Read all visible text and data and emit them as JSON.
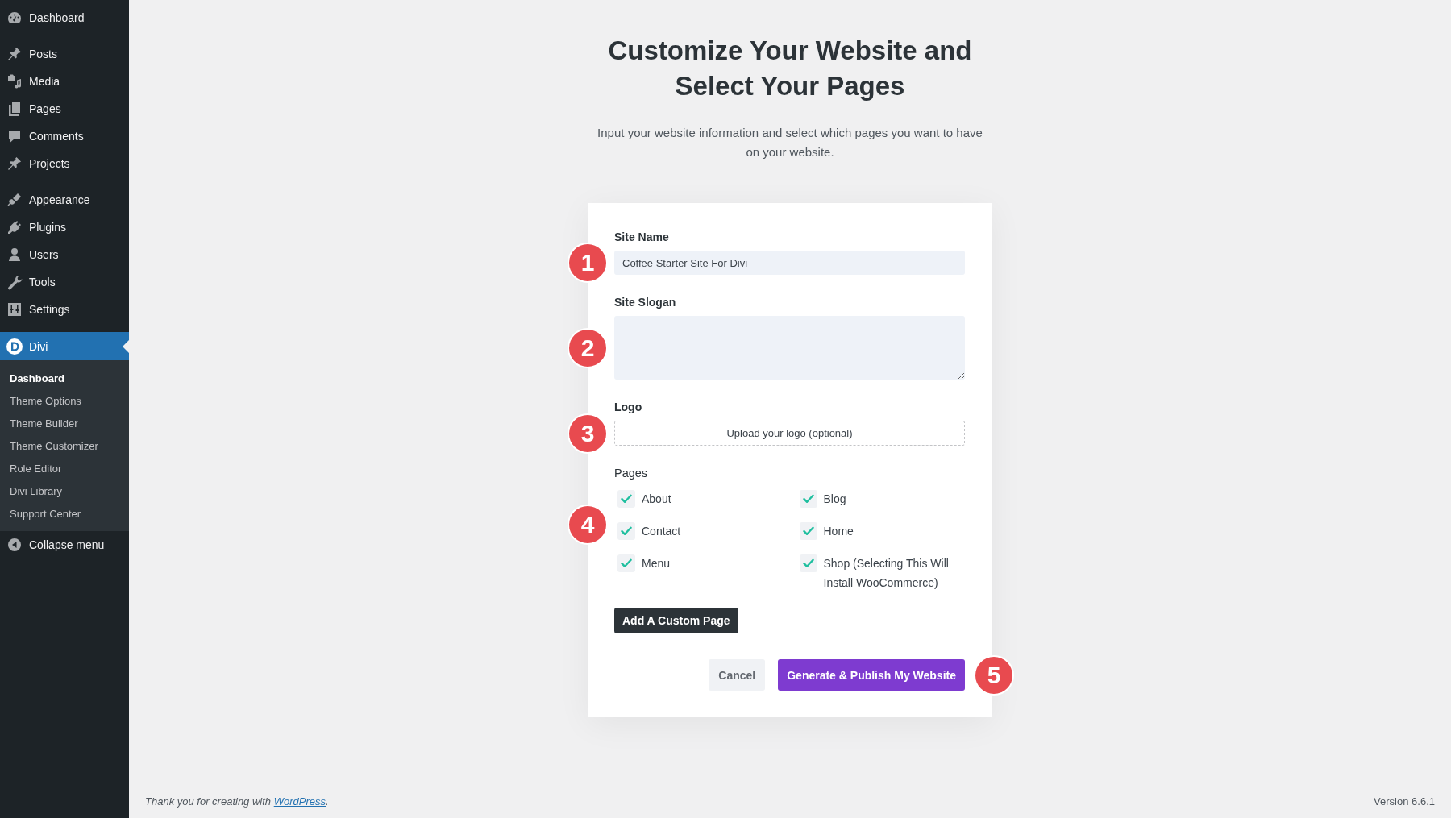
{
  "sidebar": {
    "groups": [
      [
        {
          "label": "Dashboard",
          "selected": false
        }
      ],
      [
        {
          "label": "Posts",
          "selected": false
        },
        {
          "label": "Media",
          "selected": false
        },
        {
          "label": "Pages",
          "selected": false
        },
        {
          "label": "Comments",
          "selected": false
        },
        {
          "label": "Projects",
          "selected": false
        }
      ],
      [
        {
          "label": "Appearance",
          "selected": false
        },
        {
          "label": "Plugins",
          "selected": false
        },
        {
          "label": "Users",
          "selected": false
        },
        {
          "label": "Tools",
          "selected": false
        },
        {
          "label": "Settings",
          "selected": false
        }
      ],
      [
        {
          "label": "Divi",
          "selected": true,
          "submenu": [
            {
              "label": "Dashboard",
              "selected": true
            },
            {
              "label": "Theme Options",
              "selected": false
            },
            {
              "label": "Theme Builder",
              "selected": false
            },
            {
              "label": "Theme Customizer",
              "selected": false
            },
            {
              "label": "Role Editor",
              "selected": false
            },
            {
              "label": "Divi Library",
              "selected": false
            },
            {
              "label": "Support Center",
              "selected": false
            }
          ]
        }
      ]
    ],
    "collapse_label": "Collapse menu"
  },
  "header": {
    "title": "Customize Your Website and Select Your Pages",
    "subtitle": "Input your website information and select which pages you want to have on your website."
  },
  "form": {
    "fields": [
      {
        "kind": "text",
        "label": "Site Name",
        "value": "Coffee Starter Site For Divi",
        "step": "1"
      },
      {
        "kind": "textarea",
        "label": "Site Slogan",
        "step": "2"
      },
      {
        "kind": "upload",
        "label": "Logo",
        "button": "Upload your logo (optional)",
        "step": "3"
      }
    ],
    "pages": {
      "label": "Pages",
      "step": "4",
      "items": [
        {
          "label": "About",
          "checked": true
        },
        {
          "label": "Blog",
          "checked": true
        },
        {
          "label": "Contact",
          "checked": true
        },
        {
          "label": "Home",
          "checked": true
        },
        {
          "label": "Menu",
          "checked": true
        },
        {
          "label": "Shop (Selecting This Will Install WooCommerce)",
          "checked": true
        }
      ]
    },
    "add_page_button": "Add A Custom Page",
    "actions": {
      "cancel": "Cancel",
      "submit": "Generate & Publish My Website",
      "step": "5"
    }
  },
  "footer": {
    "credit_before": "Thank you for creating with ",
    "credit_link": "WordPress",
    "credit_after": ".",
    "version": "Version 6.6.1"
  }
}
